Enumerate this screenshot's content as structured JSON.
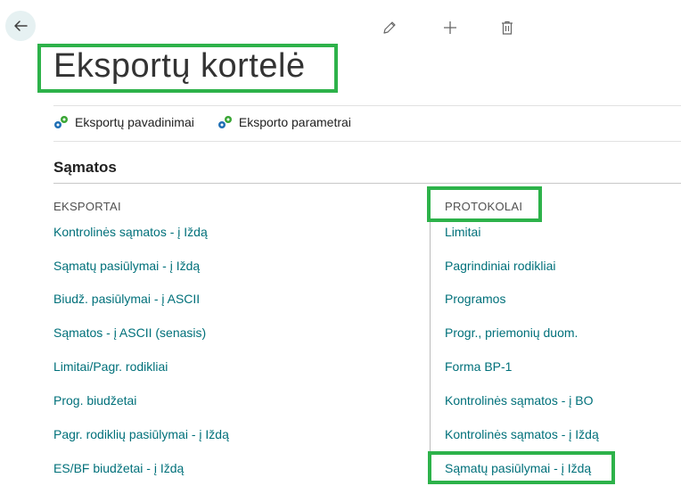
{
  "page": {
    "title": "Eksportų kortelė",
    "actions": [
      {
        "label": "Eksportų pavadinimai",
        "icon": "gears-icon"
      },
      {
        "label": "Eksporto parametrai",
        "icon": "gears-icon"
      }
    ]
  },
  "section": {
    "title": "Sąmatos",
    "left": {
      "header": "EKSPORTAI",
      "items": [
        "Kontrolinės sąmatos - į Iždą",
        "Sąmatų pasiūlymai - į Iždą",
        "Biudž. pasiūlymai - į ASCII",
        "Sąmatos - į ASCII (senasis)",
        "Limitai/Pagr. rodikliai",
        "Prog. biudžetai",
        "Pagr. rodiklių pasiūlymai - į Iždą",
        "ES/BF biudžetai - į Iždą"
      ]
    },
    "right": {
      "header": "PROTOKOLAI",
      "items": [
        "Limitai",
        "Pagrindiniai rodikliai",
        "Programos",
        "Progr., priemonių duom.",
        "Forma BP-1",
        "Kontrolinės sąmatos - į BO",
        "Kontrolinės sąmatos - į Iždą",
        "Sąmatų pasiūlymai - į Iždą"
      ]
    }
  },
  "colors": {
    "link": "#00707a",
    "highlight": "#2db24a",
    "icon_green": "#3aa635",
    "icon_blue": "#1f6fb5"
  },
  "toolbar": {
    "icons": [
      "edit-pencil-icon",
      "add-plus-icon",
      "delete-trash-icon"
    ]
  }
}
